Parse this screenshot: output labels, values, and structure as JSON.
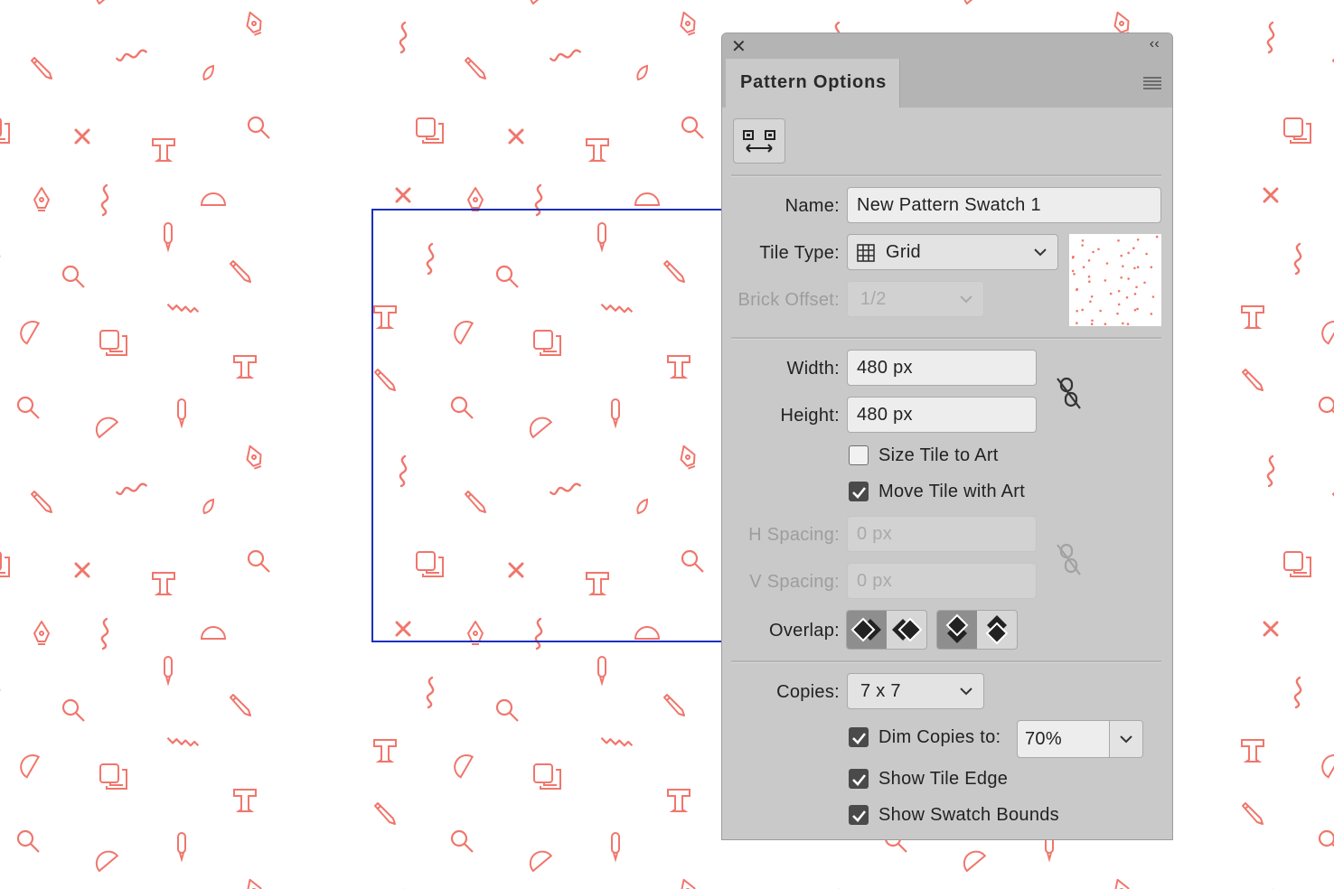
{
  "panel": {
    "title": "Pattern Options",
    "close_glyph": "✕",
    "collapse_glyph": "‹‹",
    "labels": {
      "name": "Name:",
      "tile_type": "Tile Type:",
      "brick_offset": "Brick Offset:",
      "width": "Width:",
      "height": "Height:",
      "h_spacing": "H Spacing:",
      "v_spacing": "V Spacing:",
      "overlap": "Overlap:",
      "copies": "Copies:"
    },
    "name_value": "New Pattern Swatch 1",
    "tile_type_value": "Grid",
    "brick_offset_value": "1/2",
    "width_value": "480 px",
    "height_value": "480 px",
    "h_spacing_value": "0 px",
    "v_spacing_value": "0 px",
    "copies_value": "7 x 7",
    "dim_value": "70%",
    "checkboxes": {
      "size_tile_to_art": {
        "label": "Size Tile to Art",
        "checked": false
      },
      "move_tile_with_art": {
        "label": "Move Tile with Art",
        "checked": true
      },
      "dim_copies": {
        "label": "Dim Copies to:",
        "checked": true
      },
      "show_tile_edge": {
        "label": "Show Tile Edge",
        "checked": true
      },
      "show_swatch_bounds": {
        "label": "Show Swatch Bounds",
        "checked": true
      }
    }
  },
  "colors": {
    "pattern_icon": "#f0766c",
    "tile_edge": "#1b2fbf",
    "panel_bg": "#c9c9c9"
  },
  "icons": [
    "close-icon",
    "collapse-icon",
    "panel-menu-icon",
    "pattern-tile-tool-icon",
    "grid-icon",
    "chevron-down-icon",
    "link-icon",
    "checkmark-icon",
    "overlap-left-front-icon",
    "overlap-right-front-icon",
    "overlap-top-front-icon",
    "overlap-bottom-front-icon"
  ]
}
